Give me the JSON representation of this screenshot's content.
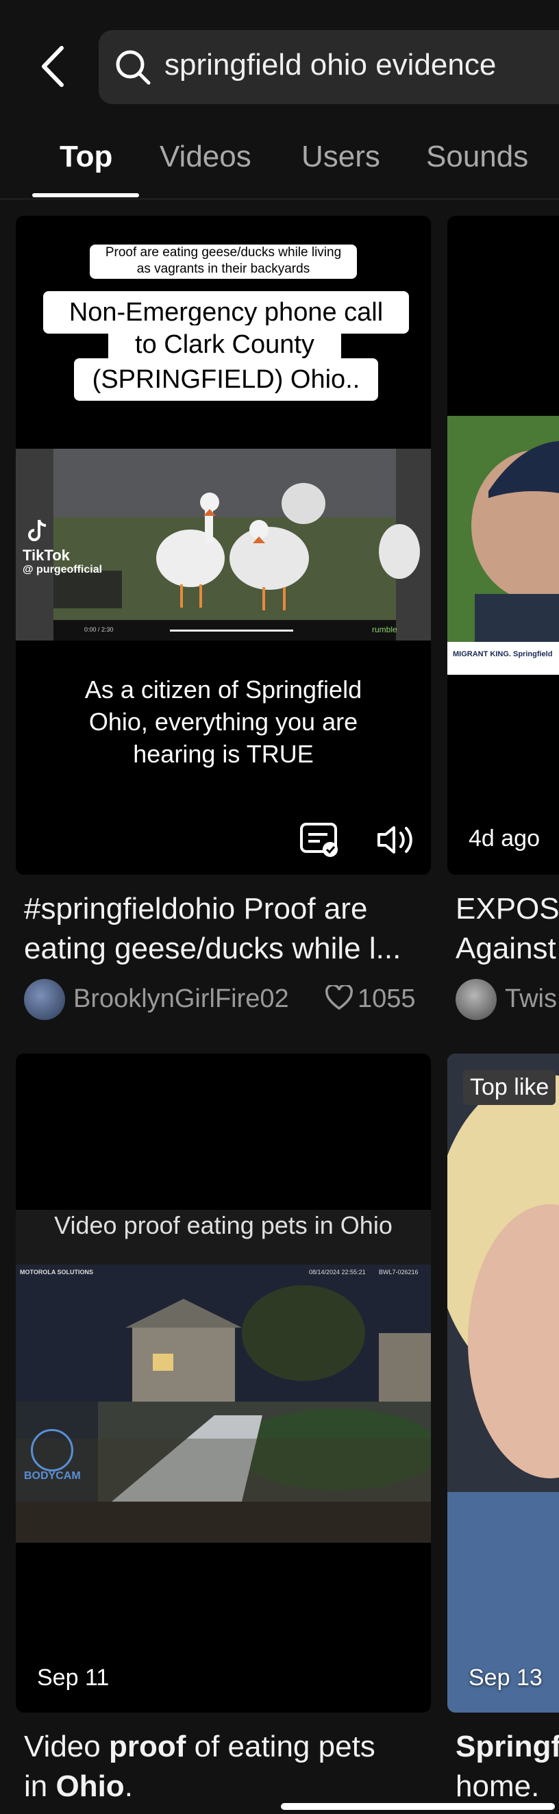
{
  "search": {
    "query": "springfield ohio evidence"
  },
  "tabs": [
    {
      "label": "Top"
    },
    {
      "label": "Videos"
    },
    {
      "label": "Users"
    },
    {
      "label": "Sounds"
    }
  ],
  "cards": [
    {
      "small_banner_line1": "Proof are eating geese/ducks while living",
      "small_banner_line2": "as vagrants in their backyards",
      "big_banner_line1": "Non-Emergency phone call",
      "big_banner_line2": "to Clark County",
      "big_banner_line3": "(SPRINGFIELD) Ohio..",
      "watermark_brand": "TikTok",
      "watermark_user": "@ purgeofficial",
      "player_time": "0:00 / 2:30",
      "player_brand": "rumble",
      "overlay_line1": "As a citizen of Springfield",
      "overlay_line2": "Ohio, everything you are",
      "overlay_line3": "hearing is TRUE",
      "caption_line1": "#springfieldohio Proof are",
      "caption_line2": "eating geese/ducks while l...",
      "author": "BrooklynGirlFire02",
      "likes": "1055"
    },
    {
      "thumb_label": "MIGRANT KING. Springfield",
      "date": "4d ago",
      "caption_line1": "EXPOS",
      "caption_line2": "Against",
      "author": "Twis"
    },
    {
      "banner": "Video proof eating pets in Ohio",
      "brand": "MOTOROLA SOLUTIONS",
      "timestamp": "08/14/2024 22:55:21",
      "device_id": "BWL7-026216",
      "cam_label": "BODYCAM",
      "date": "Sep 11",
      "caption_pre": "Video ",
      "caption_bold1": "proof",
      "caption_mid": " of eating pets",
      "caption_line2_pre": "in ",
      "caption_bold2": "Ohio",
      "caption_line2_post": "."
    },
    {
      "badge": "Top like",
      "date": "Sep 13",
      "caption_line1": "Springf",
      "caption_line2": "home."
    }
  ],
  "colors": {
    "background": "#121212",
    "search_bg": "#2a2a2a",
    "muted_text": "#9a9a9a"
  }
}
